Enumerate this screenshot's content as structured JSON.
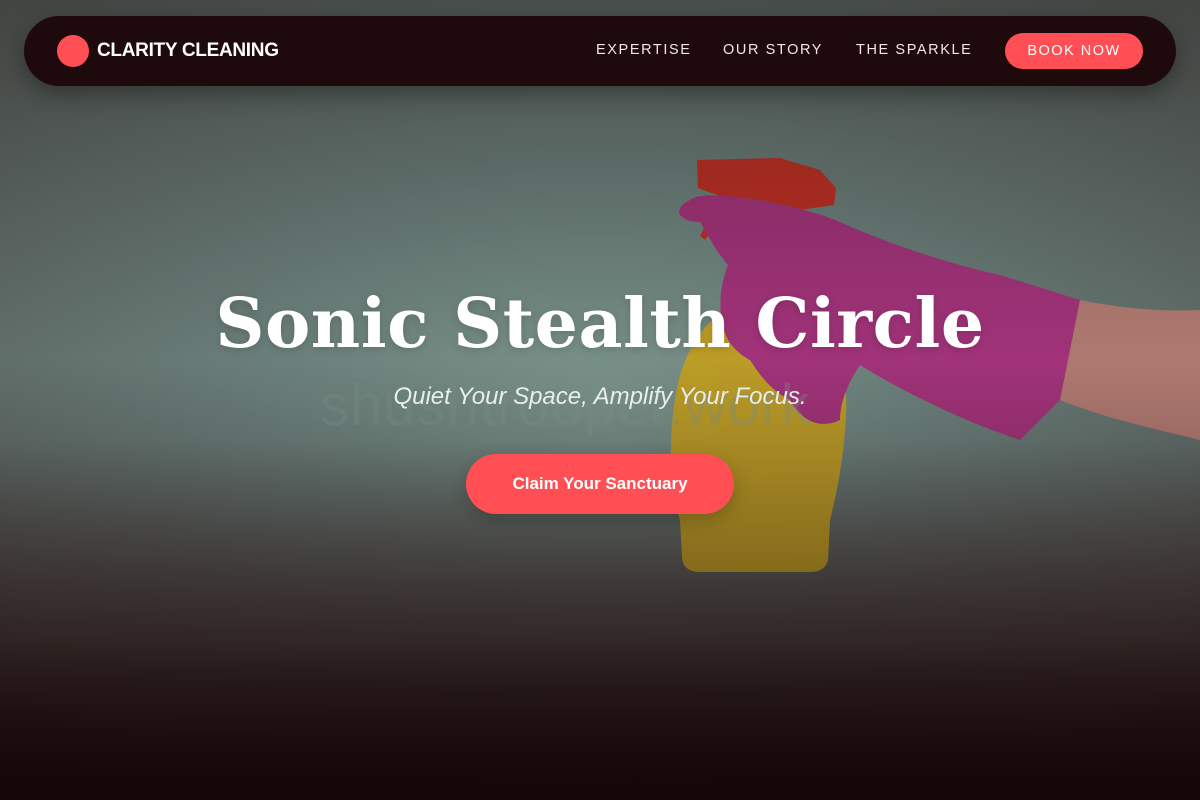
{
  "brand": {
    "name": "CLARITY CLEANING",
    "accent_color": "#ff4f55"
  },
  "nav": {
    "links": [
      "EXPERTISE",
      "OUR STORY",
      "THE SPARKLE"
    ],
    "cta_label": "BOOK NOW"
  },
  "hero": {
    "headline": "Sonic Stealth Circle",
    "subheadline": "Quiet Your Space, Amplify Your Focus.",
    "cta_label": "Claim Your Sanctuary",
    "watermark": "shushtrooper.work",
    "image": {
      "subject": "gloved hand holding spray bottle",
      "bottle_color": "#e0b92a",
      "trigger_color": "#e0332d",
      "glove_color": "#b3388e"
    }
  }
}
